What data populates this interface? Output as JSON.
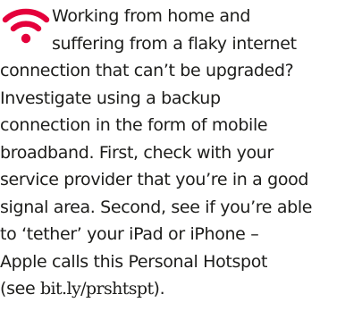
{
  "icon": {
    "name": "wifi-icon",
    "color": "#e4003b"
  },
  "tip": {
    "line1": "Working from home and",
    "line2": "suffering from a flaky internet",
    "line3": "connection that can’t be upgraded?",
    "line4": "Investigate using a backup",
    "line5": "connection in the form of mobile",
    "line6": "broadband. First, check with your",
    "line7": "service provider that you’re in a good",
    "line8": "signal area. Second, see if you’re able",
    "line9": "to ‘tether’ your iPad or iPhone –",
    "line10": "Apple calls this Personal Hotspot",
    "line11_open": "(see ",
    "line11_url": "bit.ly/prshtspt",
    "line11_close": ")."
  }
}
